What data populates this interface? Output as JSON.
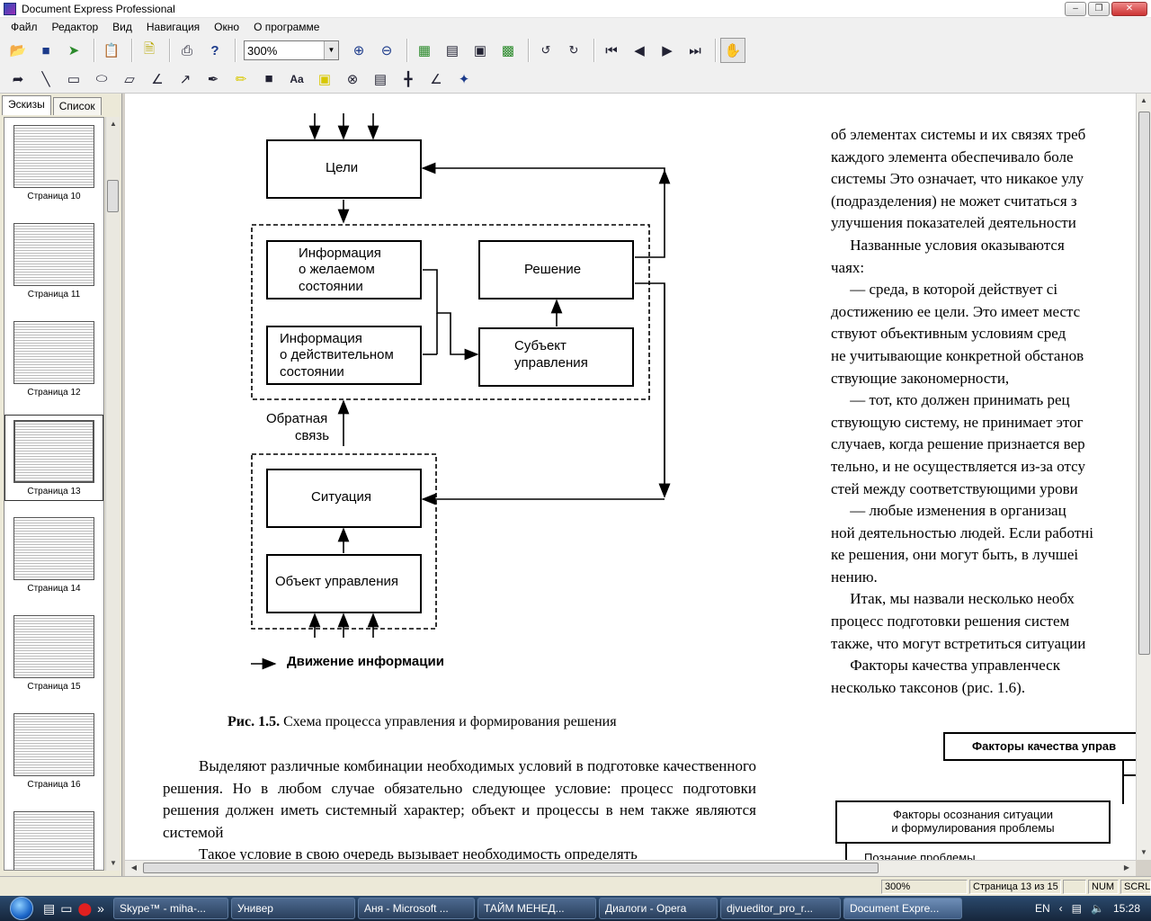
{
  "window": {
    "title": "Document Express Professional"
  },
  "menu": [
    "Файл",
    "Редактор",
    "Вид",
    "Навигация",
    "Окно",
    "О программе"
  ],
  "toolbar": {
    "zoom_value": "300%"
  },
  "toolbar2_icons": [
    "pointer-icon",
    "line-icon",
    "rectangle-icon",
    "ellipse-icon",
    "polygon-icon",
    "polyline-icon",
    "arrow-icon",
    "pen-icon",
    "highlighter-icon",
    "filled-rect-icon",
    "text-icon",
    "note-icon",
    "stamp-icon",
    "ruler-icon",
    "crosshair-icon",
    "angle-icon",
    "magic-icon"
  ],
  "sidebar": {
    "tabs": [
      "Эскизы",
      "Список"
    ],
    "thumbnails": [
      "Страница 10",
      "Страница 11",
      "Страница 12",
      "Страница 13",
      "Страница 14",
      "Страница 15",
      "Страница 16"
    ]
  },
  "document": {
    "diagram": {
      "goals": "Цели",
      "info_desired_1": "Информация",
      "info_desired_2": "о желаемом",
      "info_desired_3": "состоянии",
      "info_actual_1": "Информация",
      "info_actual_2": "о действительном",
      "info_actual_3": "состоянии",
      "decision": "Решение",
      "subject_1": "Субъект",
      "subject_2": "управления",
      "feedback_1": "Обратная",
      "feedback_2": "связь",
      "situation": "Ситуация",
      "object": "Объект управления",
      "legend": "Движение информации"
    },
    "caption_label": "Рис. 1.5.",
    "caption_text": "Схема процесса управления и формирования решения",
    "para1": "Выделяют различные комбинации необходимых условий в подготовке качественного решения. Но в любом случае обязательно следующее условие: процесс подготовки решения должен иметь системный характер; объект и процессы в нем также являются системой",
    "para2": "Такое условие в свою очередь вызывает необходимость определять",
    "right_lines": [
      "об элементах системы и их связях треб",
      "каждого элемента обеспечивало боле",
      "системы Это означает, что никакое улу",
      "(подразделения) не может считаться з",
      "улучшения показателей деятельности",
      "     Названные условия оказываются",
      "чаях:",
      "     — среда, в которой действует сі",
      "достижению ее цели. Это имеет местс",
      "ствуют объективным условиям сред",
      "не учитывающие конкретной обстанов",
      "ствующие закономерности,",
      "     — тот, кто должен принимать рец",
      "ствующую систему, не принимает этог",
      "случаев, когда решение признается вер",
      "тельно, и не осуществляется из-за отсу",
      "стей между соответствующими урови",
      "     — любые изменения в организац",
      "ной деятельностью людей. Если работні",
      "ке решения, они могут быть, в лучшеі",
      "нению.",
      "     Итак, мы назвали несколько необх",
      "процесс подготовки решения систем",
      "также, что могут встретиться ситуации",
      "     Факторы качества управленческ",
      "несколько таксонов (рис. 1.6)."
    ],
    "box_quality": "Факторы качества управ",
    "box_awareness_1": "Факторы осознания ситуации",
    "box_awareness_2": "и формулирования проблемы",
    "box_partial": "Познание проблемы"
  },
  "status": {
    "zoom": "300%",
    "page": "Страница 13 из 15",
    "num": "NUM",
    "scrl": "SCRL"
  },
  "taskbar": {
    "tasks": [
      "Skype™ - miha-...",
      "Универ",
      "Аня - Microsoft ...",
      "ТАЙМ МЕНЕД...",
      "Диалоги - Opera",
      "djvueditor_pro_r...",
      "Document Expre..."
    ],
    "lang": "EN",
    "time": "15:28"
  }
}
